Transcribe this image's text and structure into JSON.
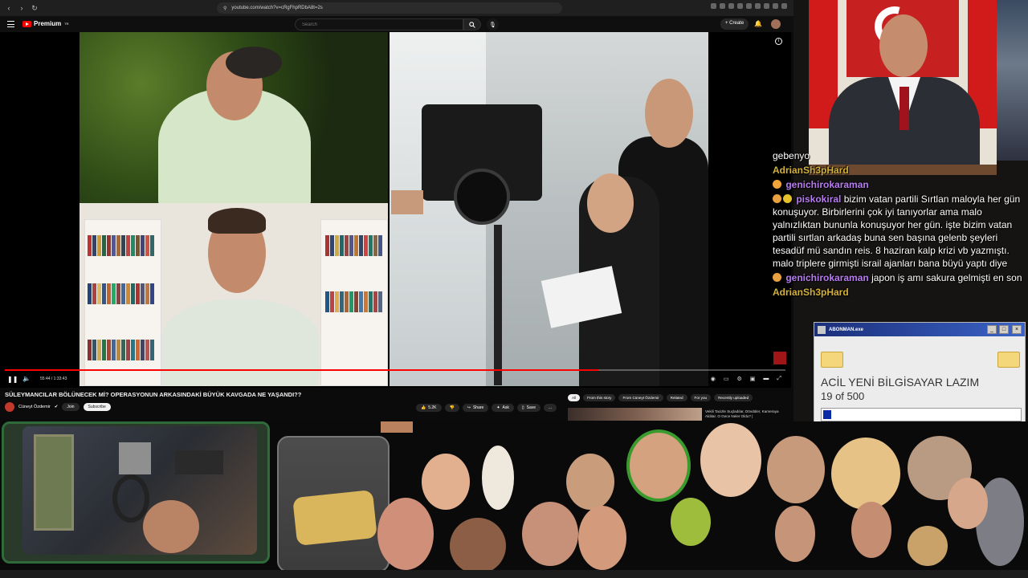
{
  "browser": {
    "url": "youtube.com/watch?v=cRgFhpRDbA8t=2s"
  },
  "topbar": {
    "logo_text": "Premium",
    "logo_badge": "TR",
    "search_placeholder": "Search",
    "create_label": "Create"
  },
  "player": {
    "time": "55:44 / 1:33:43",
    "progress": 0.76
  },
  "video": {
    "title": "SÜLEYMANCILAR BÖLÜNECEK Mİ? OPERASYONUN ARKASINDAKİ BÜYÜK KAVGADA NE YAŞANDI??",
    "channel": "Cüneyt Özdemir",
    "join_label": "Join",
    "subscribe_label": "Subscribe",
    "likes": "5.2K",
    "share_label": "Share",
    "ask_label": "Ask",
    "save_label": "Save",
    "more_label": "..."
  },
  "chips": [
    "All",
    "From this story",
    "From Cüneyt Özdemir",
    "Related",
    "For you",
    "Recently uploaded"
  ],
  "recommended": {
    "title": "Vekili Tacizle Suçladılar, Dövdüler, Kameraya Aldılar. O Gece Neler Oldu? |"
  },
  "chat": {
    "messages": [
      {
        "name": "",
        "text": "gebenyo",
        "name_color": "#ffffff"
      },
      {
        "name": "AdrianSh3pHard",
        "text": "",
        "name_color": "#d4b13a"
      },
      {
        "name": "genichirokaraman",
        "text": "",
        "name_color": "#b77cf0"
      },
      {
        "name": "piskokiral",
        "text": "bizim vatan partili Sırtlan maloyla her gün konuşuyor. Birbirlerini çok iyi tanıyorlar ama malo yalnızlıktan bununla konuşuyor her gün. işte bizim vatan partili sırtlan arkadaş buna sen başına gelenb şeyleri tesadüf mü sandın reis. 8 haziran kalp krizi vb yazmıştı. malo triplere girmişti israil ajanları bana büyü yaptı diye",
        "name_color": "#b77cf0"
      },
      {
        "name": "genichirokaraman",
        "text": "japon iş amı sakura gelmişti en son",
        "name_color": "#b77cf0"
      },
      {
        "name": "AdrianSh3pHard",
        "text": "",
        "name_color": "#d4b13a"
      }
    ]
  },
  "dialog": {
    "title": "ABONMAN.exe",
    "message": "ACİL YENİ BİLGİSAYAR LAZIM",
    "count": "19 of 500",
    "progress": 0.038
  },
  "colors": {
    "yt_red": "#ff0000",
    "dialog_blue": "#0a2aa6",
    "frame_green": "#2f6a3a"
  }
}
